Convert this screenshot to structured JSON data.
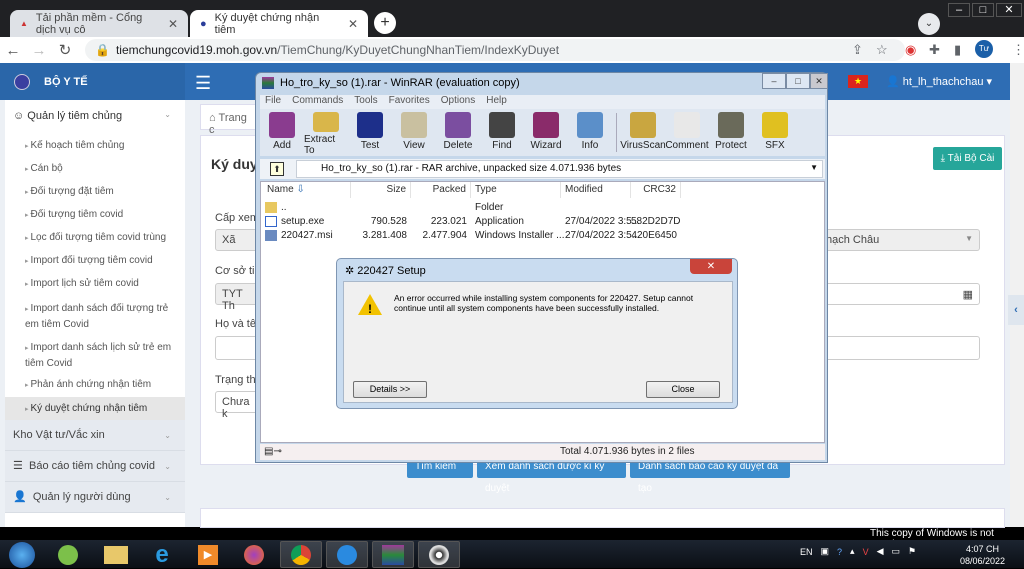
{
  "browser": {
    "tabs": [
      {
        "label": "Tải phần mềm - Cổng dịch vụ cô"
      },
      {
        "label": "Ký duyệt chứng nhận tiêm"
      }
    ],
    "url_host": "tiemchungcovid19.moh.gov.vn",
    "url_path": "/TiemChung/KyDuyetChungNhanTiem/IndexKyDuyet",
    "profile_initial": "Tư"
  },
  "site": {
    "brand": "BỘ Y TẾ",
    "user": "ht_lh_thachchau",
    "breadcrumb": "Trang c",
    "page_title": "Ký duyệ",
    "download_button": "Tải Bộ Cài",
    "sidebar": {
      "group1": "Quản lý tiêm chủng",
      "items": [
        "Kế hoạch tiêm chủng",
        "Cán bộ",
        "Đối tượng đặt tiêm",
        "Đối tượng tiêm covid",
        "Lọc đối tượng tiêm covid trùng",
        "Import đối tượng tiêm covid",
        "Import lịch sử tiêm covid",
        "Import danh sách đối tượng trẻ em tiêm Covid",
        "Import danh sách lịch sử trẻ em tiêm Covid",
        "Phản ánh chứng nhận tiêm",
        "Ký duyệt chứng nhận tiêm"
      ],
      "group2": "Kho Vật tư/Vắc xin",
      "group3": "Báo cáo tiêm chủng covid",
      "group4": "Quản lý người dùng"
    },
    "form": {
      "cap_xem_label": "Cấp xem",
      "cap_xem_value": "Xã",
      "cap_xem_right": "hạch Châu",
      "co_so_label": "Cơ sở tiê",
      "co_so_value": "TYT Th",
      "ho_ten_label": "Họ và tê",
      "trang_thai_label": "Trạng th",
      "trang_thai_value": "Chưa k"
    },
    "buttons": [
      "Tìm kiếm",
      "Xem danh sách được kí ký duyệt",
      "Danh sách báo cáo ký duyệt đã tạo"
    ]
  },
  "winrar": {
    "title": "Ho_tro_ky_so (1).rar - WinRAR (evaluation copy)",
    "menu": [
      "File",
      "Commands",
      "Tools",
      "Favorites",
      "Options",
      "Help"
    ],
    "tools": [
      {
        "label": "Add",
        "color": "#8a3c8f"
      },
      {
        "label": "Extract To",
        "color": "#d9b64a"
      },
      {
        "label": "Test",
        "color": "#1d2f8a"
      },
      {
        "label": "View",
        "color": "#c9c0a0"
      },
      {
        "label": "Delete",
        "color": "#7b4ea0"
      },
      {
        "label": "Find",
        "color": "#444444"
      },
      {
        "label": "Wizard",
        "color": "#8a2b6a"
      },
      {
        "label": "Info",
        "color": "#5b8fc9"
      },
      {
        "label": "VirusScan",
        "color": "#c9a640"
      },
      {
        "label": "Comment",
        "color": "#e8e8e8"
      },
      {
        "label": "Protect",
        "color": "#6a6a5a"
      },
      {
        "label": "SFX",
        "color": "#e0c020"
      }
    ],
    "path": "Ho_tro_ky_so (1).rar - RAR archive, unpacked size 4.071.936 bytes",
    "columns": [
      "Name",
      "Size",
      "Packed",
      "Type",
      "Modified",
      "CRC32"
    ],
    "rows": [
      {
        "name": "..",
        "size": "",
        "packed": "",
        "type": "Folder",
        "modified": "",
        "crc": ""
      },
      {
        "name": "setup.exe",
        "size": "790.528",
        "packed": "223.021",
        "type": "Application",
        "modified": "27/04/2022 3:5...",
        "crc": "582D2D7D"
      },
      {
        "name": "220427.msi",
        "size": "3.281.408",
        "packed": "2.477.904",
        "type": "Windows Installer ...",
        "modified": "27/04/2022 3:5...",
        "crc": "420E6450"
      }
    ],
    "status": "Total 4.071.936 bytes in 2 files"
  },
  "dialog": {
    "title": "220427 Setup",
    "message": "An error occurred while installing system components for 220427. Setup cannot continue until all system components have been successfully installed.",
    "details_button": "Details >>",
    "close_button": "Close"
  },
  "os": {
    "watermark": "This copy of Windows is not genuine",
    "lang": "EN",
    "time": "4:07 CH",
    "date": "08/06/2022"
  }
}
